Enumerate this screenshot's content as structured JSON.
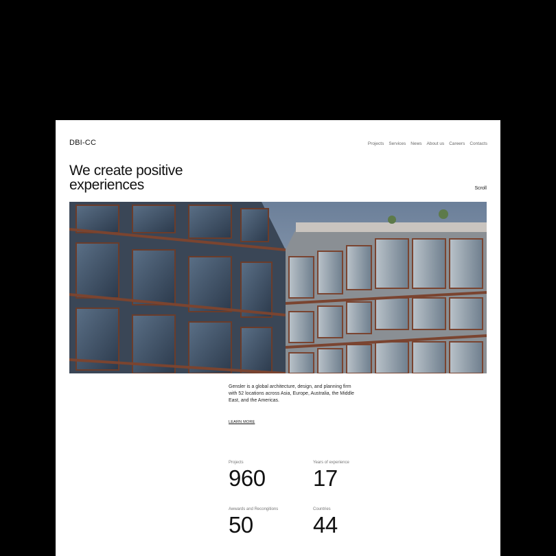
{
  "header": {
    "logo": "DBI-CC",
    "nav": [
      "Projects",
      "Services",
      "News",
      "About us",
      "Careers",
      "Contacts"
    ]
  },
  "hero": {
    "title": "We create positive experiences",
    "scroll_label": "Scroll"
  },
  "intro": {
    "text": "Gensler is a global architecture, design, and planning firm with 52 locations across Asia, Europe, Australia, the Middle East, and the Americas.",
    "link_label": "LEARN MORE"
  },
  "stats": [
    {
      "label": "Projects",
      "value": "960"
    },
    {
      "label": "Years of experience",
      "value": "17"
    },
    {
      "label": "Awwards and Recongitions",
      "value": "50"
    },
    {
      "label": "Countries",
      "value": "44"
    }
  ]
}
